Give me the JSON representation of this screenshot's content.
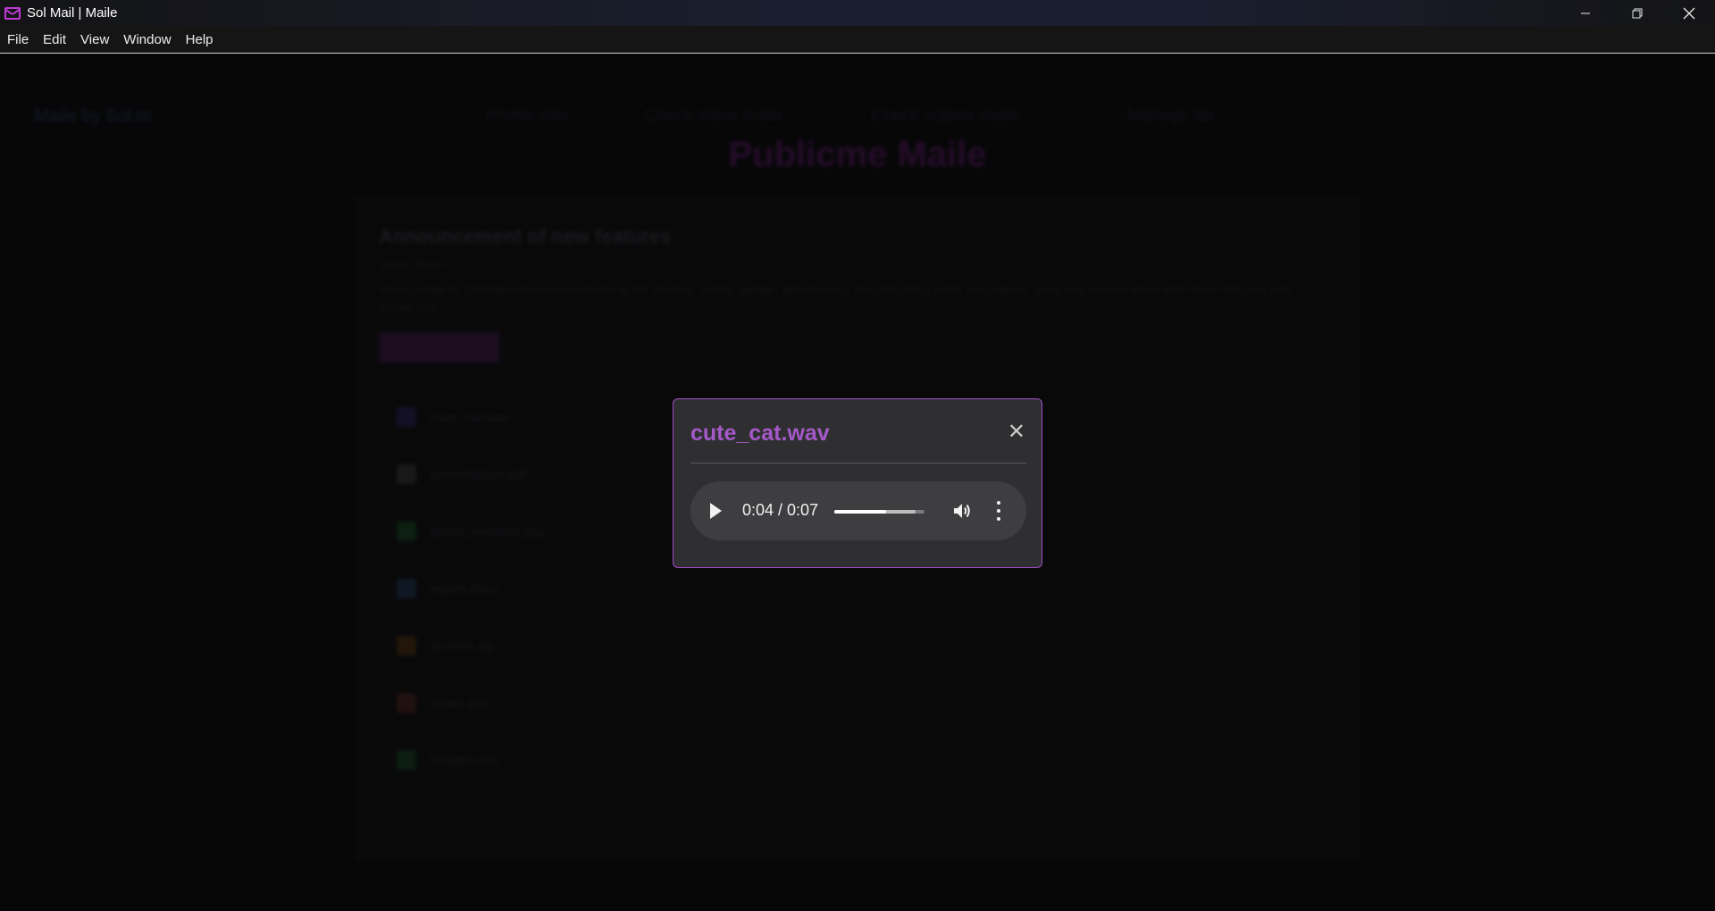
{
  "window": {
    "title": "Sol Mail | Maile",
    "controls": [
      "minimize",
      "restore",
      "close"
    ]
  },
  "menu": [
    "File",
    "Edit",
    "View",
    "Window",
    "Help"
  ],
  "colors": {
    "accent": "#a559c8",
    "modal_border": "#a04cc8",
    "app_icon": "#c03bd8"
  },
  "background": {
    "brand": "Maile by Sol.m",
    "nav_links": [
      "Profile info",
      "Check inbox mails",
      "Check outbox mails",
      "Manage ids"
    ],
    "heading": "Publicme Maile",
    "card": {
      "title": "Announcement of new features",
      "subtitle": "Sol.m Team",
      "body": "New update to Sol Mail with improvements to file sharing. In this update, attach many files including audio and videos, send and receive them with more features and easier use.",
      "button": "Download",
      "attachments": [
        "cute_cat.wav",
        "presentation.pdf",
        "photo_vacation.jpg",
        "report.docx",
        "archive.zip",
        "slides.ppt",
        "budget.xlsx"
      ],
      "attachment_icon_colors": [
        "#1e1a3a",
        "#262626",
        "#13301a",
        "#1a2438",
        "#33220f",
        "#331a1a",
        "#13301a"
      ]
    }
  },
  "modal": {
    "title": "cute_cat.wav",
    "close_label": "✕",
    "player": {
      "time_display": "0:04 / 0:07",
      "current_time": "0:04",
      "duration": "0:07",
      "progress_fraction": 0.57,
      "buffered_fraction": 0.9
    }
  }
}
